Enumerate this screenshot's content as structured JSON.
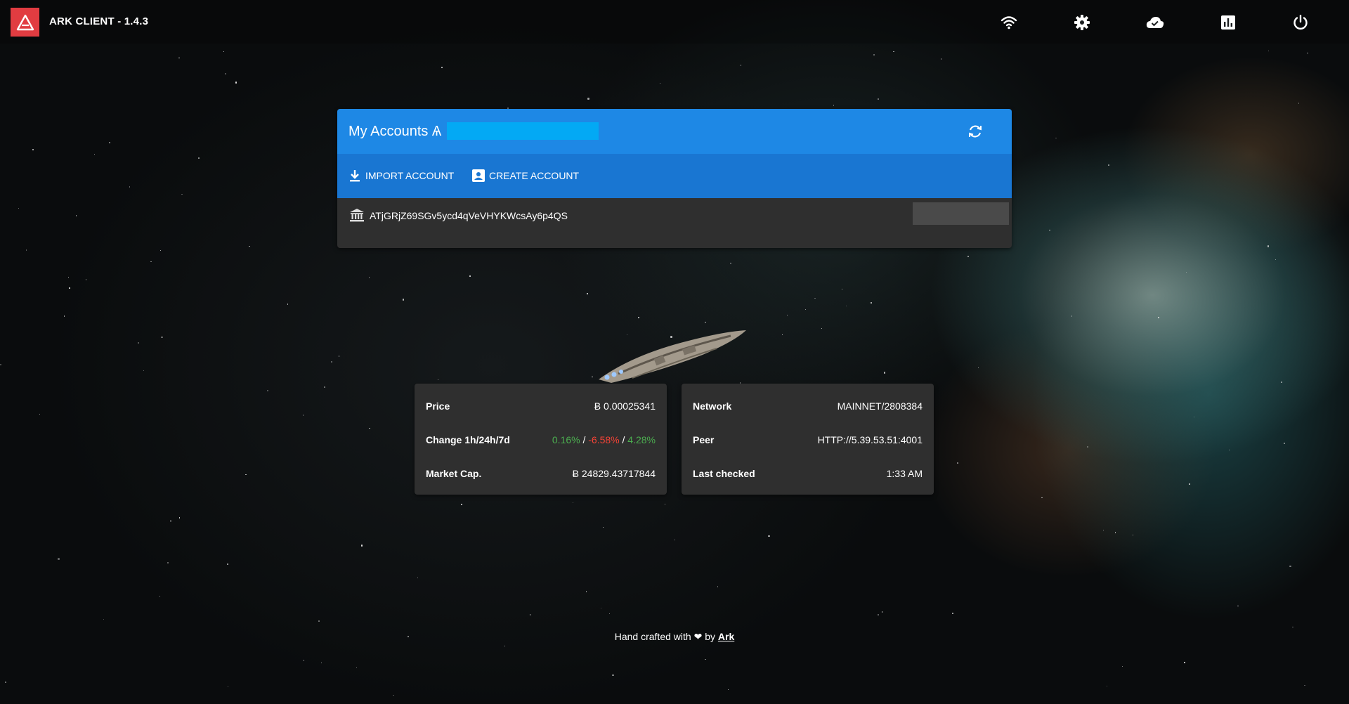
{
  "app": {
    "title": "ARK CLIENT - 1.4.3"
  },
  "topbar": {
    "icons": [
      "wifi-icon",
      "gear-icon",
      "cloud-icon",
      "chart-icon",
      "power-icon"
    ]
  },
  "accounts": {
    "title": "My Accounts Ѧ",
    "import_label": "IMPORT ACCOUNT",
    "create_label": "CREATE ACCOUNT",
    "items": [
      {
        "address": "ATjGRjZ69SGv5ycd4qVeVHYKWcsAy6p4QS"
      }
    ]
  },
  "market": {
    "price_label": "Price",
    "price_value": "Ƀ 0.00025341",
    "change_label": "Change 1h/24h/7d",
    "change_1h": "0.16%",
    "change_24h": "-6.58%",
    "change_7d": "4.28%",
    "separator": "/",
    "marketcap_label": "Market Cap.",
    "marketcap_value": "Ƀ 24829.43717844"
  },
  "network": {
    "network_label": "Network",
    "network_value": "MAINNET/2808384",
    "peer_label": "Peer",
    "peer_value": "HTTP://5.39.53.51:4001",
    "checked_label": "Last checked",
    "checked_value": "1:33 AM"
  },
  "footer": {
    "text": "Hand crafted with",
    "by": "by",
    "link": "Ark"
  },
  "colors": {
    "header_blue": "#1e88e5",
    "toolbar_blue": "#1976d2",
    "logo_red": "#e13c41",
    "positive": "#4caf50",
    "negative": "#f44336"
  }
}
